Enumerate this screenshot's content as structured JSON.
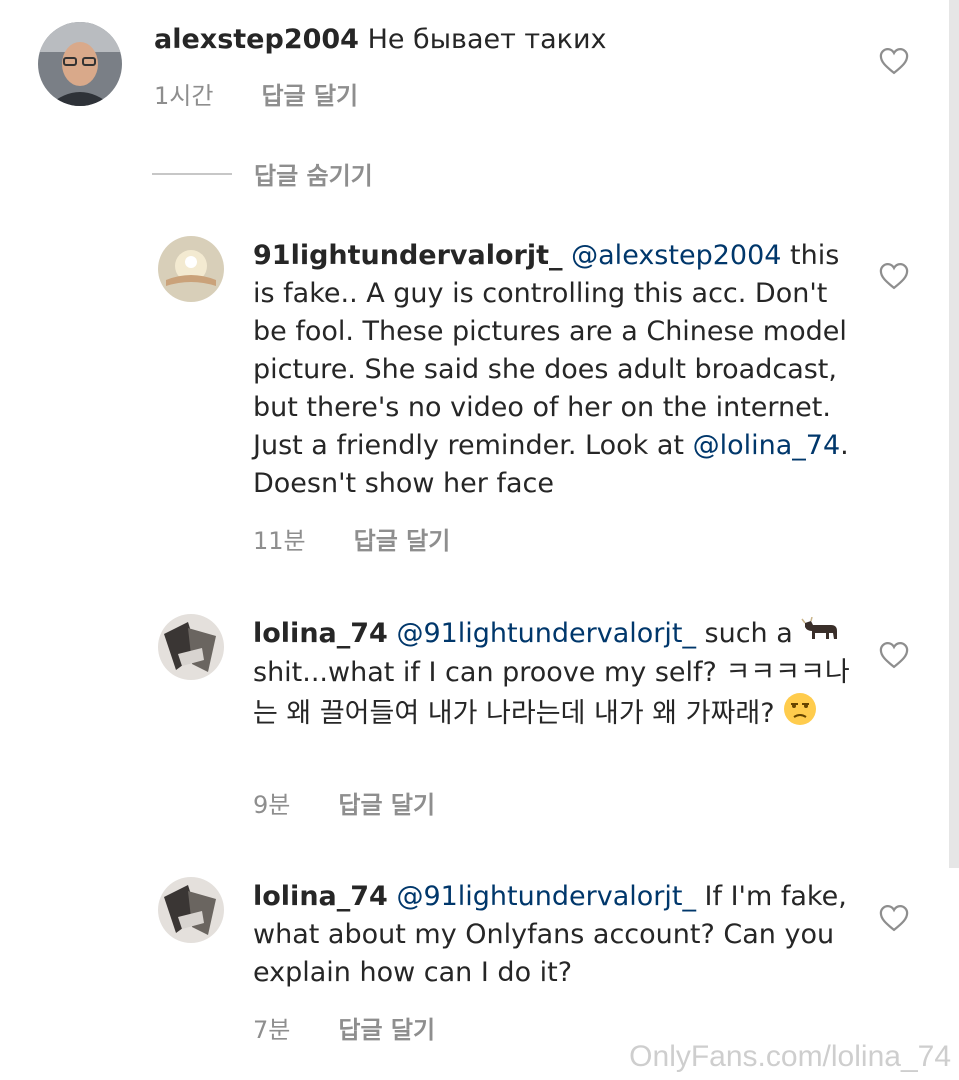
{
  "comments": [
    {
      "username": "alexstep2004",
      "mention": "",
      "text": "Не бывает таких",
      "time": "1시간",
      "reply_label": "답글 달기"
    },
    {
      "username": "91lightundervalorjt_",
      "mention": "@alexstep2004",
      "text_part1": " this is fake.. A guy is controlling this acc. Don't be fool. These pictures are a Chinese model picture. She said she does adult broadcast, but there's no video of her on the internet. Just a friendly reminder. Look at ",
      "mention2": "@lolina_74",
      "text_part2": ". Doesn't show her face",
      "time": "11분",
      "reply_label": "답글 달기"
    },
    {
      "username": "lolina_74",
      "mention": "@91lightundervalorjt_",
      "text_part1": " such a ",
      "text_part2": " shit...what if I can proove my self? ㅋㅋㅋㅋ나는 왜 끌어들여 내가 나라는데 내가 왜 가짜래? ",
      "time": "9분",
      "reply_label": "답글 달기"
    },
    {
      "username": "lolina_74",
      "mention": "@91lightundervalorjt_",
      "text": " If I'm fake, what about my Onlyfans account? Can you explain how can I do it?",
      "time": "7분",
      "reply_label": "답글 달기"
    }
  ],
  "hide_replies_label": "답글 숨기기",
  "icons": {
    "like": "heart-outline-icon",
    "bull_emoji": "ox-emoji",
    "unamused_emoji": "unamused-face-emoji"
  },
  "watermark": "OnlyFans.com/lolina_74",
  "colors": {
    "text": "#262626",
    "secondary": "#8e8e8e",
    "mention": "#00376b"
  }
}
